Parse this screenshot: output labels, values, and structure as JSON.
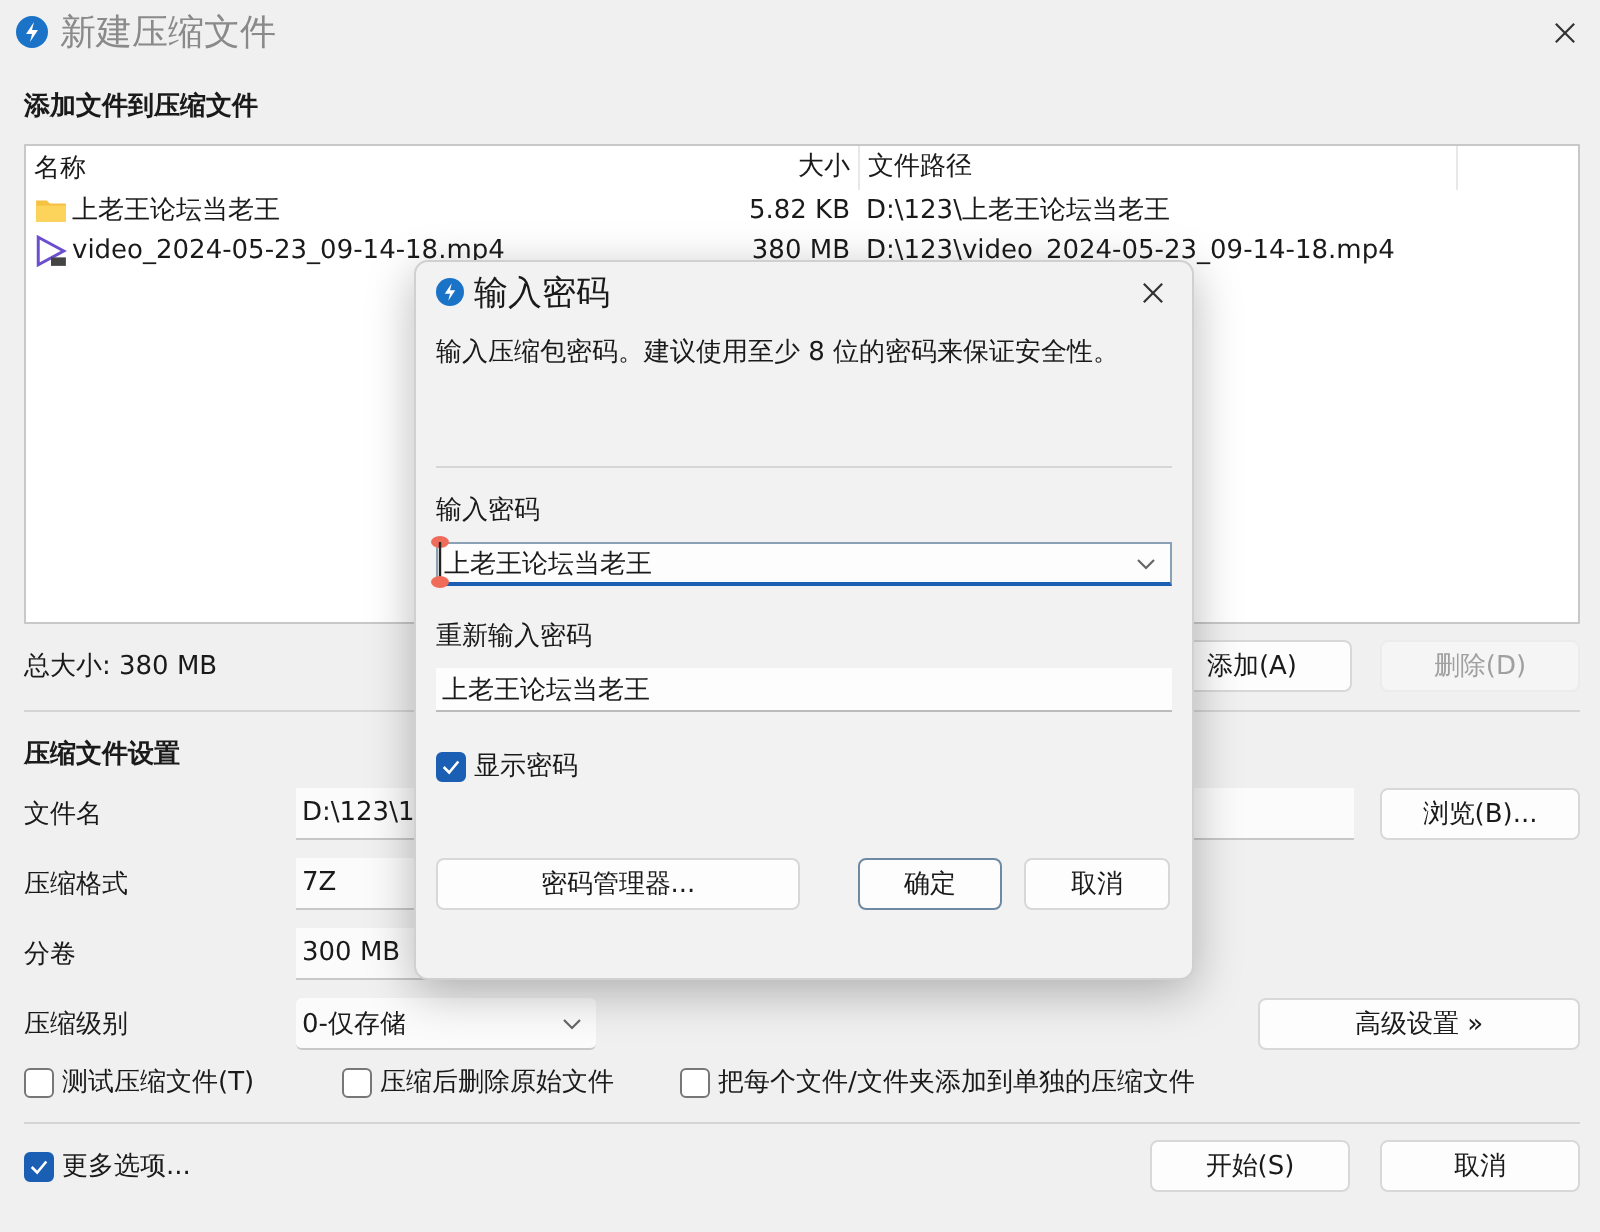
{
  "window": {
    "title": "新建压缩文件"
  },
  "files": {
    "heading": "添加文件到压缩文件",
    "columns": [
      "名称",
      "大小",
      "文件路径"
    ],
    "rows": [
      {
        "kind": "folder",
        "name": "上老王论坛当老王",
        "size": "5.82 KB",
        "path": "D:\\123\\上老王论坛当老王"
      },
      {
        "kind": "video",
        "name": "video_2024-05-23_09-14-18.mp4",
        "size": "380 MB",
        "path": "D:\\123\\video_2024-05-23_09-14-18.mp4"
      }
    ],
    "total": "总大小: 380 MB",
    "buttons": [
      {
        "label": "添加(A)",
        "disabled": false
      },
      {
        "label": "删除(D)",
        "disabled": true
      }
    ]
  },
  "settings": {
    "heading": "压缩文件设置",
    "fields": [
      {
        "kind": "text",
        "label": "文件名",
        "value": "D:\\123\\1"
      },
      {
        "kind": "text",
        "label": "压缩格式",
        "value": "7Z"
      },
      {
        "kind": "text",
        "label": "分卷",
        "value": "300 MB"
      },
      {
        "kind": "combo",
        "label": "压缩级别",
        "value": "0-仅存储"
      }
    ],
    "browse": "浏览(B)...",
    "advanced": "高级设置 »",
    "options": [
      {
        "label": "测试压缩文件(T)",
        "checked": false
      },
      {
        "label": "压缩后删除原始文件",
        "checked": false
      },
      {
        "label": "把每个文件/文件夹添加到单独的压缩文件",
        "checked": false
      }
    ]
  },
  "footer": {
    "more": {
      "label": "更多选项...",
      "checked": true
    },
    "buttons": [
      "开始(S)",
      "取消"
    ]
  },
  "dialog": {
    "title": "输入密码",
    "message": "输入压缩包密码。建议使用至少 8 位的密码来保证安全性。",
    "password_label": "输入密码",
    "password": "上老王论坛当老王",
    "confirm_label": "重新输入密码",
    "confirm": "上老王论坛当老王",
    "show": {
      "label": "显示密码",
      "checked": true
    },
    "buttons": [
      {
        "label": "密码管理器...",
        "default": false
      },
      {
        "label": "确定",
        "default": true
      },
      {
        "label": "取消",
        "default": false
      }
    ]
  }
}
